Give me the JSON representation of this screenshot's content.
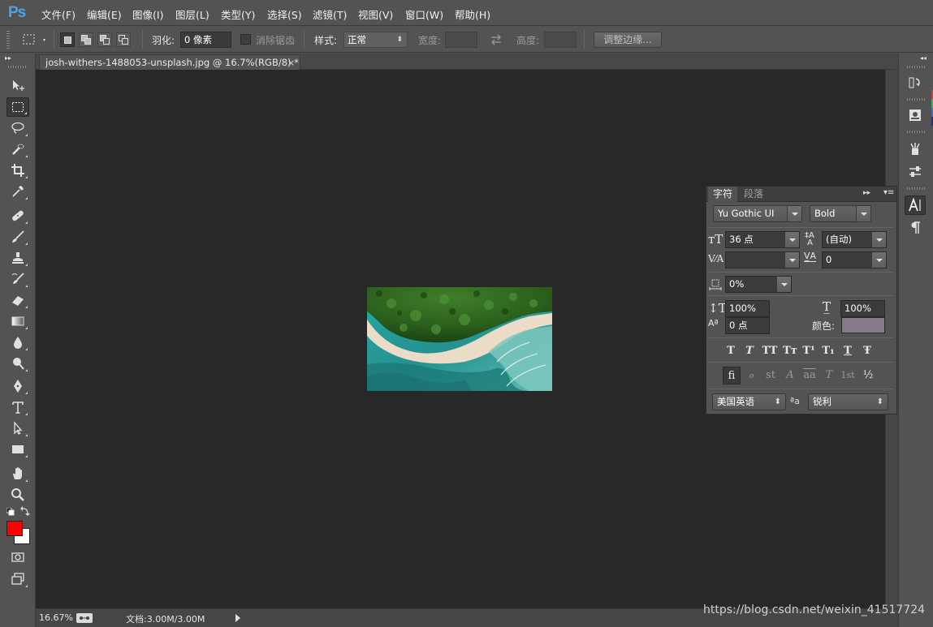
{
  "app": {
    "logo": "Ps"
  },
  "menu": [
    "文件(F)",
    "编辑(E)",
    "图像(I)",
    "图层(L)",
    "类型(Y)",
    "选择(S)",
    "滤镜(T)",
    "视图(V)",
    "窗口(W)",
    "帮助(H)"
  ],
  "options": {
    "feather_label": "羽化:",
    "feather_value": "0 像素",
    "antialias_label": "消除锯齿",
    "style_label": "样式:",
    "style_value": "正常",
    "width_label": "宽度:",
    "height_label": "高度:",
    "refine_edge": "调整边缘..."
  },
  "document": {
    "tab_title": "josh-withers-1488053-unsplash.jpg @ 16.7%(RGB/8) *",
    "close_glyph": "×"
  },
  "status": {
    "zoom": "16.67%",
    "doc_info": "文档:3.00M/3.00M"
  },
  "colors": {
    "foreground": "#ff0000",
    "background": "#ffffff",
    "text_color_swatch": "#867a8a"
  },
  "character_panel": {
    "tab_character": "字符",
    "tab_paragraph": "段落",
    "font_family": "Yu Gothic UI",
    "font_style": "Bold",
    "font_size": "36 点",
    "leading": "(自动)",
    "kerning": "",
    "tracking": "0",
    "tsume": "0%",
    "vertical_scale": "100%",
    "horizontal_scale": "100%",
    "baseline_shift": "0 点",
    "color_label": "颜色:",
    "style_buttons": [
      "T",
      "T",
      "TT",
      "Tт",
      "T¹",
      "T₁",
      "T",
      "Ŧ"
    ],
    "opentype_buttons": [
      "ﬁ",
      "ℴ",
      "st",
      "A",
      "aa",
      "T",
      "1st",
      "½"
    ],
    "language": "美国英语",
    "aa_glyph": "ªa",
    "antialias": "锐利"
  },
  "tools": [
    "move-tool",
    "rect-marquee-tool",
    "lasso-tool",
    "quick-select-tool",
    "crop-tool",
    "eyedropper-tool",
    "healing-brush-tool",
    "brush-tool",
    "clone-stamp-tool",
    "history-brush-tool",
    "eraser-tool",
    "gradient-tool",
    "blur-tool",
    "dodge-tool",
    "pen-tool",
    "type-tool",
    "path-select-tool",
    "rectangle-tool",
    "hand-tool",
    "zoom-tool"
  ],
  "watermark": "https://blog.csdn.net/weixin_41517724"
}
